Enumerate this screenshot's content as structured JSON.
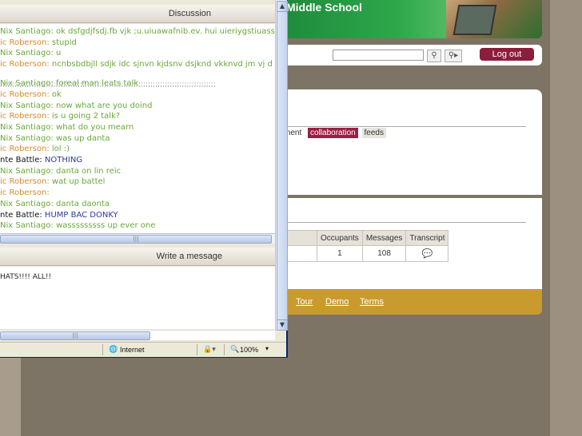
{
  "site": {
    "banner_title": "Middle School",
    "logout_label": "Log out",
    "search_value": "",
    "tabs": [
      {
        "label": "ment",
        "active": false
      },
      {
        "label": "collaboration",
        "active": true
      },
      {
        "label": "feeds",
        "active": false
      }
    ],
    "rooms_table": {
      "headers": [
        "Occupants",
        "Messages",
        "Transcript"
      ],
      "rows": [
        {
          "occupants": "1",
          "messages": "108"
        }
      ]
    },
    "footer_links": [
      "Tour",
      "Demo",
      "Terms"
    ]
  },
  "chat": {
    "discussion_label": "Discussion",
    "write_label": "Write a message",
    "message_text": "HATS!!!! ALL!!",
    "lines": [
      {
        "name": "Nix Santiago:",
        "text": "ok dsfgdjfsdj.fb vjk ;u.uiuawafnib.ev. hui uieriygstiuassassaa",
        "nc": "green",
        "tc": ""
      },
      {
        "name": "ic Roberson:",
        "text": "stupid",
        "nc": "",
        "tc": ""
      },
      {
        "name": "Nix Santiago:",
        "text": "u",
        "nc": "green",
        "tc": ""
      },
      {
        "name": "ic Roberson:",
        "text": "ncnbsbdbjll sdjk idc sjnvn kjdsnv dsjknd vkknvd jm vj d js d sj",
        "nc": "",
        "tc": ""
      },
      {
        "name": "Nix Santiago:",
        "text": "foreal man leats talk",
        "nc": "green",
        "tc": ""
      },
      {
        "name": "ic Roberson:",
        "text": "ok",
        "nc": "",
        "tc": ""
      },
      {
        "name": "Nix Santiago:",
        "text": "now what are you doind",
        "nc": "green",
        "tc": ""
      },
      {
        "name": "ic Roberson:",
        "text": "is u going 2 talk?",
        "nc": "",
        "tc": ""
      },
      {
        "name": "Nix Santiago:",
        "text": "what do you mearn",
        "nc": "green",
        "tc": ""
      },
      {
        "name": "Nix Santiago:",
        "text": "was up danta",
        "nc": "green",
        "tc": ""
      },
      {
        "name": "ic Roberson:",
        "text": "lol :)",
        "nc": "",
        "tc": ""
      },
      {
        "name": "nte Battle:",
        "text": "NOTHING",
        "nc": "black",
        "tc": "blue"
      },
      {
        "name": "Nix Santiago:",
        "text": "danta on lin reic",
        "nc": "green",
        "tc": ""
      },
      {
        "name": "ic Roberson:",
        "text": "wat up battel",
        "nc": "",
        "tc": ""
      },
      {
        "name": "ic Roberson:",
        "text": "",
        "nc": "",
        "tc": ""
      },
      {
        "name": "Nix Santiago:",
        "text": "danta daonta",
        "nc": "green",
        "tc": ""
      },
      {
        "name": "nte Battle:",
        "text": "HUMP BAC DONKY",
        "nc": "black",
        "tc": "blue"
      },
      {
        "name": "Nix Santiago:",
        "text": "wasssssssss up ever one",
        "nc": "green",
        "tc": ""
      }
    ]
  },
  "status": {
    "zone": "Internet",
    "zoom": "100%"
  },
  "colors": {
    "accent": "#9c1e44",
    "footer": "#c99a2e",
    "banner": "#2ea84a"
  }
}
